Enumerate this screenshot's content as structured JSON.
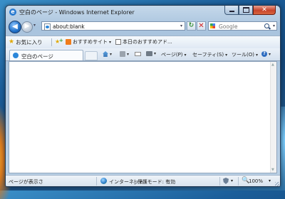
{
  "window": {
    "title": "空白のページ - Windows Internet Explorer",
    "app_icon": "e"
  },
  "caption_buttons": {
    "minimize_icon": "minimize-icon",
    "maximize_icon": "maximize-icon",
    "close_glyph": "✕"
  },
  "navigation": {
    "back_glyph": "◀",
    "forward_glyph": "▶",
    "dropdown_glyph": "▾"
  },
  "address_bar": {
    "value": "about:blank",
    "dropdown_glyph": "▾",
    "refresh_glyph": "↻",
    "stop_glyph": "✕"
  },
  "search": {
    "placeholder": "Google",
    "dropdown_glyph": "▾"
  },
  "favorites_bar": {
    "favorites_label": "お気に入り",
    "star_glyph": "★",
    "add_glyph": "★",
    "add_plus": "+",
    "suggested_sites_label": "おすすめサイト",
    "webslice_label": "本日のおすすめアド...",
    "dropdown_glyph": "▾"
  },
  "tabs": {
    "active_tab_label": "空白のページ"
  },
  "command_bar": {
    "page_label": "ページ(P)",
    "safety_label": "セーフティ(S)",
    "tools_label": "ツール(O)",
    "help_glyph": "?",
    "dropdown_glyph": "▾"
  },
  "status_bar": {
    "status_text": "ページが表示さ",
    "zone_text": "インターネット",
    "protected_mode_text": "| 保護モード: 有効",
    "zoom_glyph": "🔍",
    "zoom_text": "100%",
    "dropdown_glyph": "▾"
  },
  "scrollbar": {
    "up_glyph": "▲",
    "down_glyph": "▼"
  },
  "colors": {
    "accent_blue": "#2a7bd0",
    "close_red": "#c7442b"
  }
}
